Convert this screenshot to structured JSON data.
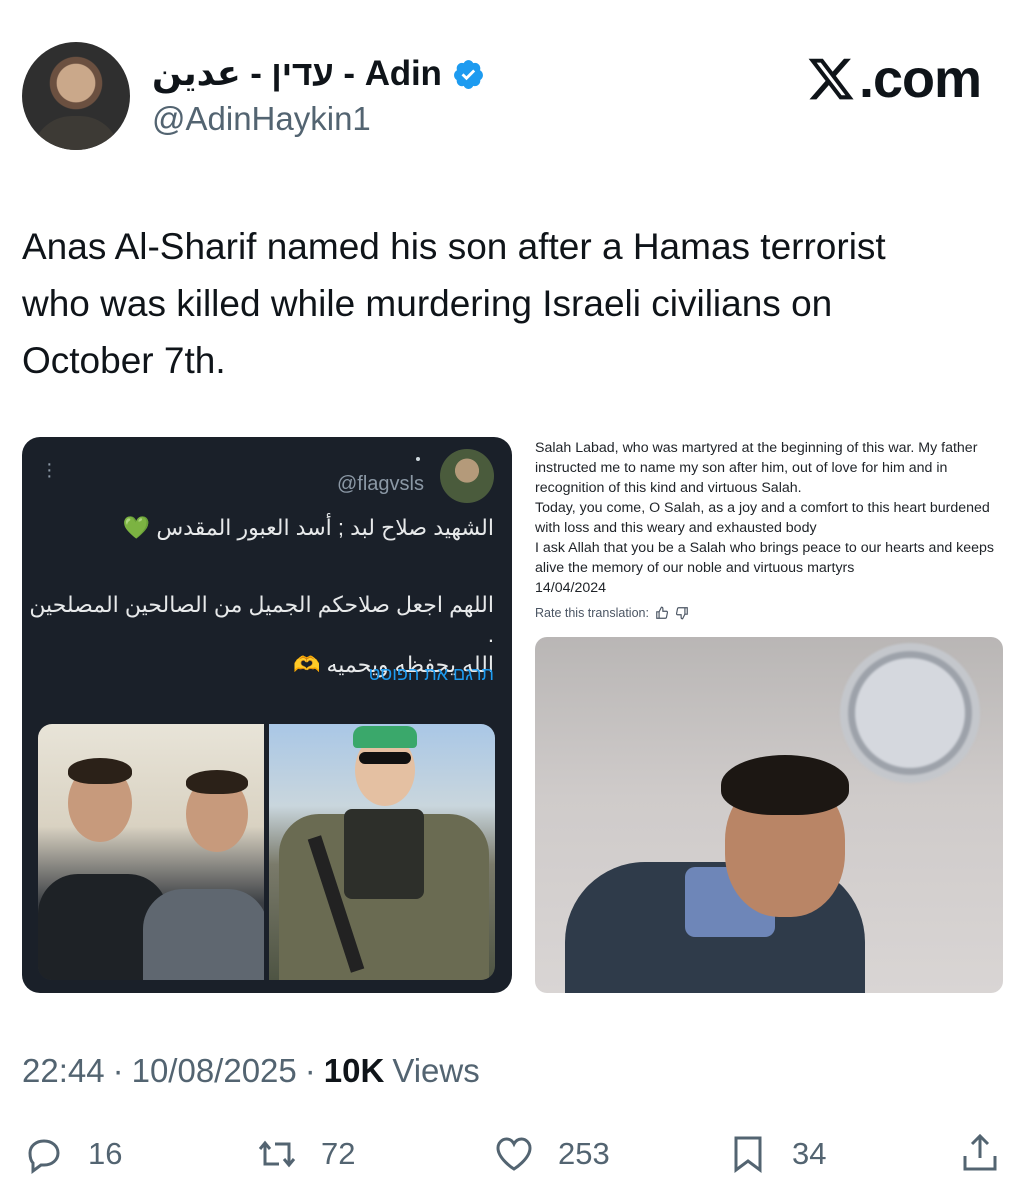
{
  "author": {
    "display_name": "עדין - عدين - Adin",
    "handle": "@AdinHaykin1",
    "verified": true
  },
  "brand": {
    "label": ".com",
    "icon": "x-logo-icon"
  },
  "tweet": {
    "text": "Anas Al-Sharif named his son after a Hamas terrorist who was killed while murdering Israeli civilians on October 7th."
  },
  "embedded_left": {
    "handle": "@flagvsls",
    "line1": "الشهيد صلاح لبد ; أسد العبور المقدس 💚",
    "line2": "اللهم اجعل صلاحكم الجميل من الصالحين المصلحين .",
    "line3": "الله يحفظه ويحميه 🫶",
    "translate_label": "תרגם את הפוסט"
  },
  "embedded_right": {
    "lines": [
      "Salah Labad, who was martyred at the beginning of this war. My father instructed me to name my son after him, out of love for him and in recognition of this kind and virtuous Salah.",
      "Today, you come, O Salah, as a joy and a comfort to this heart burdened with loss and this weary and exhausted body",
      "I ask Allah that you be a Salah who brings peace to our hearts and keeps alive the memory of our noble and virtuous martyrs",
      "14/04/2024"
    ],
    "rate_label": "Rate this translation:"
  },
  "meta": {
    "time": "22:44",
    "date": "10/08/2025",
    "views_count": "10K",
    "views_label": "Views"
  },
  "actions": {
    "replies": "16",
    "reposts": "72",
    "likes": "253",
    "bookmarks": "34"
  },
  "colors": {
    "text": "#0f1419",
    "secondary": "#536471",
    "verified_blue": "#1d9bf0",
    "embed_bg": "#1a2029"
  }
}
